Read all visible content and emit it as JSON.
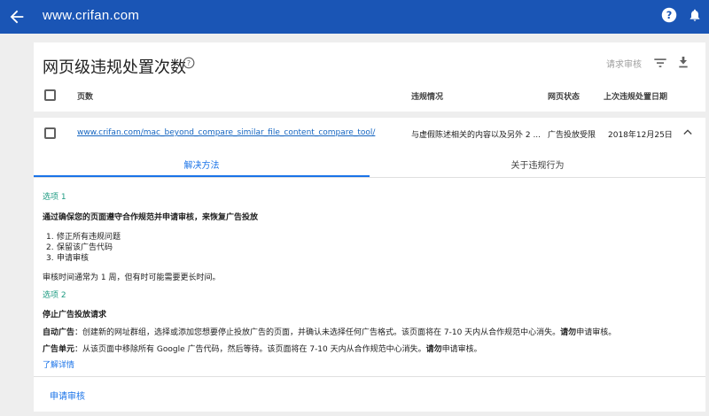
{
  "appbar": {
    "title": "www.crifan.com",
    "icons": [
      "back-arrow-icon",
      "help-icon",
      "bell-icon"
    ]
  },
  "header": {
    "title": "网页级违规处置次数",
    "request_review": "请求审核",
    "columns": [
      "页数",
      "违规情况",
      "网页状态",
      "上次违规处置日期"
    ]
  },
  "row": {
    "url": "www.crifan.com/mac_beyond_compare_similar_file_content_compare_tool/",
    "violation": "与虚假陈述相关的内容以及另外 2 ...",
    "status": "广告投放受限",
    "date": "2018年12月25日"
  },
  "tabs": [
    "解决方法",
    "关于违规行为"
  ],
  "option1": {
    "label": "选项 1",
    "heading": "通过确保您的页面遵守合作规范并申请审核，来恢复广告投放",
    "steps": [
      "修正所有违规问题",
      "保留该广告代码",
      "申请审核"
    ],
    "note": "审核时间通常为 1 周，但有时可能需要更长时间。"
  },
  "option2": {
    "label": "选项 2",
    "heading": "停止广告投放请求",
    "auto_label": "自动广告",
    "auto_text": "：创建新的网址群组，选择或添加您想要停止投放广告的页面，并确认未选择任何广告格式。该页面将在 7-10 天内从合作规范中心消失。",
    "auto_warn": "请勿",
    "auto_end": "申请审核。",
    "unit_label": "广告单元",
    "unit_text": "：从该页面中移除所有 Google 广告代码，然后等待。该页面将在 7-10 天内从合作规范中心消失。",
    "unit_warn": "请勿",
    "unit_end": "申请审核。",
    "learn_more": "了解详情"
  },
  "apply_button": "申请审核",
  "colors": {
    "appbar": "#1a55b5",
    "accent": "#1a73e8",
    "option": "#1e9b82"
  }
}
